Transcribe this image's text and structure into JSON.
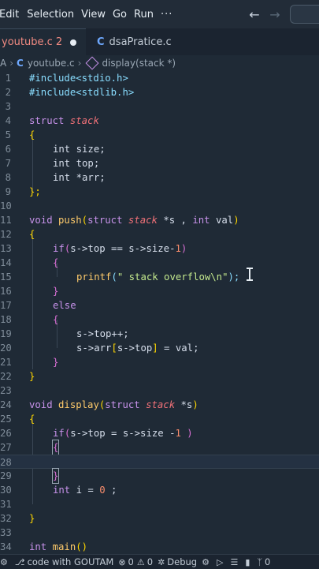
{
  "menu": {
    "items": [
      "Edit",
      "Selection",
      "View",
      "Go",
      "Run",
      "···"
    ]
  },
  "nav": {
    "back": "←",
    "forward": "→"
  },
  "tabs": [
    {
      "label": "youtube.c 2",
      "modified": true
    },
    {
      "label": "dsaPratice.c",
      "icon": "C"
    }
  ],
  "breadcrumb": {
    "first": "A",
    "file": "youtube.c",
    "symbol": "display(stack *)"
  },
  "lines": [
    {
      "n": "1"
    },
    {
      "n": "2"
    },
    {
      "n": "3"
    },
    {
      "n": "4"
    },
    {
      "n": "5"
    },
    {
      "n": "6"
    },
    {
      "n": "7"
    },
    {
      "n": "8"
    },
    {
      "n": "9"
    },
    {
      "n": "10"
    },
    {
      "n": "11"
    },
    {
      "n": "12"
    },
    {
      "n": "13"
    },
    {
      "n": "14"
    },
    {
      "n": "15"
    },
    {
      "n": "16"
    },
    {
      "n": "17"
    },
    {
      "n": "18"
    },
    {
      "n": "19"
    },
    {
      "n": "20"
    },
    {
      "n": "21"
    },
    {
      "n": "22"
    },
    {
      "n": "23"
    },
    {
      "n": "24"
    },
    {
      "n": "25"
    },
    {
      "n": "26"
    },
    {
      "n": "27"
    },
    {
      "n": "28"
    },
    {
      "n": "29"
    },
    {
      "n": "30"
    },
    {
      "n": "31"
    },
    {
      "n": "32"
    },
    {
      "n": "33"
    },
    {
      "n": "34"
    }
  ],
  "code": {
    "l1": "#include<stdio.h>",
    "l2": "#include<stdlib.h>",
    "l4a": "struct ",
    "l4b": "stack",
    "l5": "{",
    "l6": "int size;",
    "l7": "int top;",
    "l8": "int *arr;",
    "l9": "};",
    "l11a": "void ",
    "l11b": "push",
    "l11c": "(",
    "l11d": "struct ",
    "l11e": "stack ",
    "l11f": "*s , ",
    "l11g": "int ",
    "l11h": "val",
    "l11i": ")",
    "l12": "{",
    "l13a": "if",
    "l13b": "(",
    "l13c": "s->top == s->size-",
    "l13d": "1",
    "l13e": ")",
    "l14": "{",
    "l15a": "printf",
    "l15b": "(",
    "l15c": "\" stack overflow\\n\"",
    "l15d": ");",
    "l16": "}",
    "l17": "else",
    "l18": "{",
    "l19": "s->top++;",
    "l20a": "s->arr",
    "l20b": "[",
    "l20c": "s->top",
    "l20d": "]",
    "l20e": " = val;",
    "l21": "}",
    "l22": "}",
    "l24a": "void ",
    "l24b": "display",
    "l24c": "(",
    "l24d": "struct ",
    "l24e": "stack ",
    "l24f": "*s",
    "l24g": ")",
    "l25": "{",
    "l26a": "if",
    "l26b": "(",
    "l26c": "s->top = s->size -",
    "l26d": "1 ",
    "l26e": ")",
    "l27": "{",
    "l29": "}",
    "l30a": "int ",
    "l30b": "i = ",
    "l30c": "0",
    "l30d": " ;",
    "l32": "}",
    "l34a": "int ",
    "l34b": "main",
    "l34c": "()"
  },
  "status": {
    "branch": "code with GOUTAM",
    "errors": "0",
    "warnings": "0",
    "debug": "Debug",
    "ports": "0"
  }
}
